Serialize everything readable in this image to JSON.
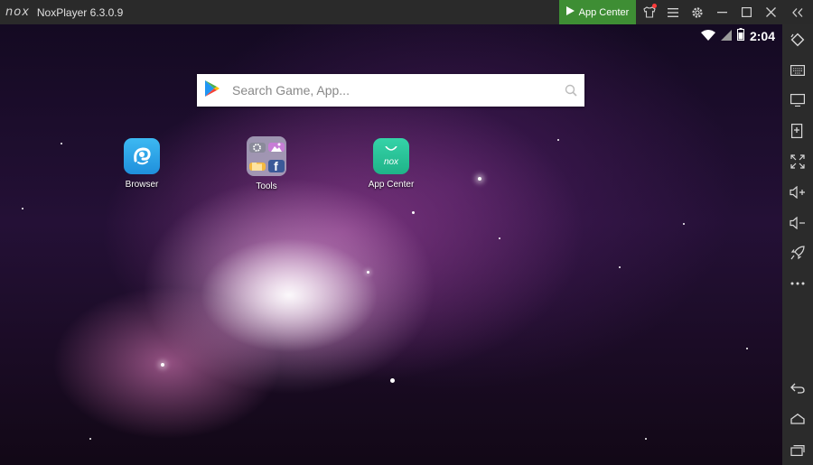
{
  "titlebar": {
    "logo": "nox",
    "title": "NoxPlayer 6.3.0.9",
    "app_center_label": "App Center",
    "icons": [
      "play-icon",
      "shirt-icon",
      "menu-icon",
      "gear-icon",
      "minimize-icon",
      "maximize-icon",
      "close-icon",
      "collapse-icon"
    ]
  },
  "statusbar": {
    "time": "2:04"
  },
  "search": {
    "placeholder": "Search Game, App..."
  },
  "apps": [
    {
      "label": "Browser"
    },
    {
      "label": "Tools"
    },
    {
      "label": "App Center"
    }
  ],
  "app_icon_text": {
    "app_center": "nox"
  },
  "sidebar": {
    "icons": [
      "rotate-icon",
      "keyboard-icon",
      "screen-icon",
      "add-apk-icon",
      "fullscreen-icon",
      "volume-up-icon",
      "volume-down-icon",
      "rocket-icon",
      "more-icon",
      "back-icon",
      "home-icon",
      "recent-apps-icon"
    ]
  },
  "colors": {
    "accent": "#3e8e34",
    "browser": "#2fa6e8",
    "appcenter": "#27c39a"
  }
}
